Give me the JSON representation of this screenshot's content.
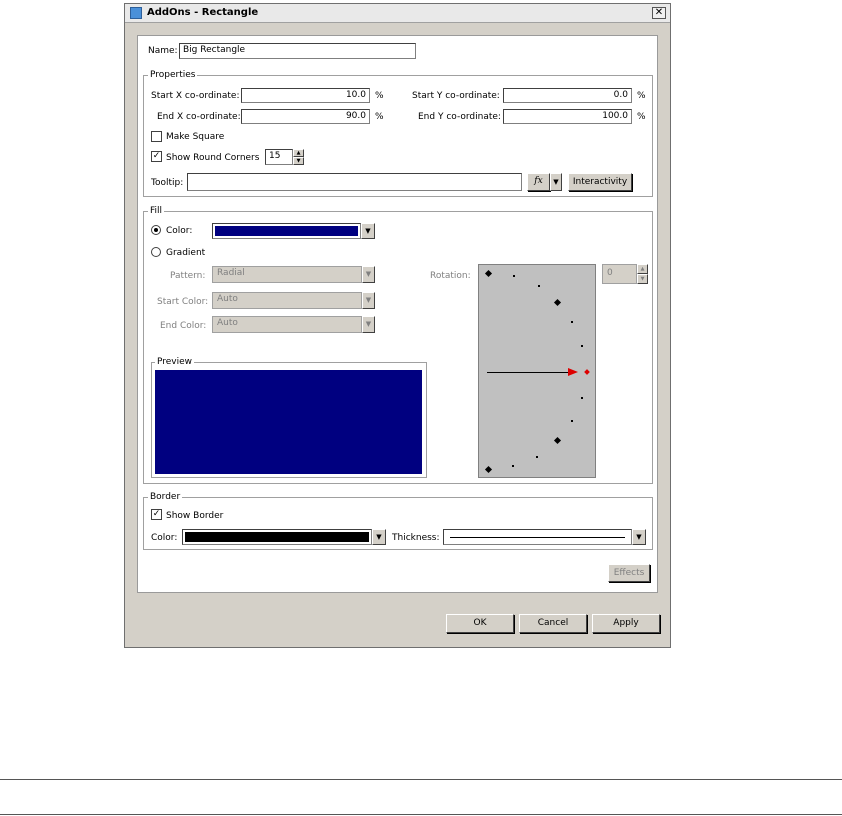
{
  "window": {
    "title": "AddOns - Rectangle",
    "close_glyph": "✕"
  },
  "name_row": {
    "label": "Name:",
    "value": "Big Rectangle"
  },
  "properties": {
    "legend": "Properties",
    "start_x": {
      "label": "Start X co-ordinate:",
      "value": "10.0",
      "unit": "%"
    },
    "end_x": {
      "label": "End X co-ordinate:",
      "value": "90.0",
      "unit": "%"
    },
    "start_y": {
      "label": "Start Y co-ordinate:",
      "value": "0.0",
      "unit": "%"
    },
    "end_y": {
      "label": "End Y co-ordinate:",
      "value": "100.0",
      "unit": "%"
    },
    "make_square": {
      "label": "Make Square",
      "checked": false
    },
    "round_corners": {
      "label": "Show Round Corners",
      "checked": true,
      "value": "15"
    },
    "tooltip": {
      "label": "Tooltip:",
      "value": ""
    },
    "fx_label": "fx",
    "interactivity_label": "Interactivity"
  },
  "fill": {
    "legend": "Fill",
    "color_label": "Color:",
    "color_value": "#000080",
    "gradient_label": "Gradient",
    "pattern": {
      "label": "Pattern:",
      "value": "Radial"
    },
    "start_color": {
      "label": "Start Color:",
      "value": "Auto"
    },
    "end_color": {
      "label": "End Color:",
      "value": "Auto"
    },
    "rotation": {
      "label": "Rotation:",
      "value": "0"
    },
    "preview_legend": "Preview",
    "selected": "color"
  },
  "border": {
    "legend": "Border",
    "show_border": {
      "label": "Show Border",
      "checked": true
    },
    "color_label": "Color:",
    "color_value": "#000000",
    "thickness_label": "Thickness:"
  },
  "buttons": {
    "effects": "Effects",
    "ok": "OK",
    "cancel": "Cancel",
    "apply": "Apply"
  },
  "accents": {
    "dialog_bg": "#d4d0c8",
    "rotation_marker": "#dd0000"
  },
  "glyphs": {
    "check": "✓",
    "dropdown": "▼",
    "spin_up": "▲",
    "spin_down": "▼"
  }
}
